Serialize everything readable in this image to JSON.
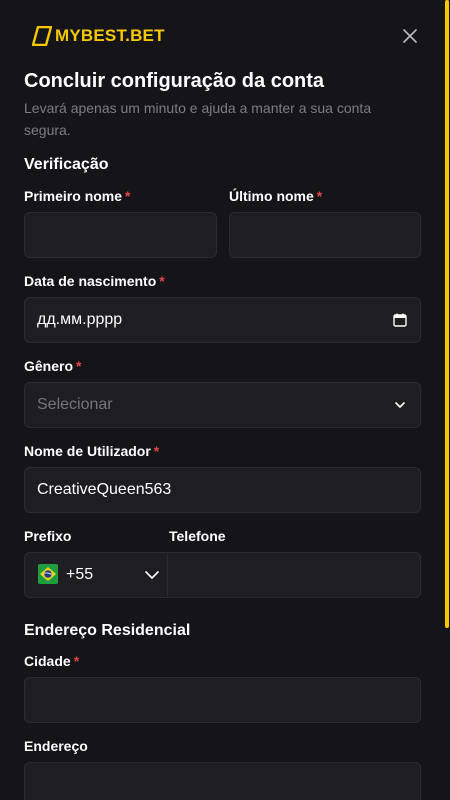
{
  "brand": {
    "logo_text": "MYBEST.BET",
    "accent": "#f6c800"
  },
  "dialog": {
    "title": "Concluir configuração da conta",
    "subtitle": "Levará apenas um minuto e ajuda a manter a sua conta segura."
  },
  "sections": {
    "verification": "Verificação",
    "address": "Endereço Residencial"
  },
  "required_mark": "*",
  "fields": {
    "first_name": {
      "label": "Primeiro nome",
      "value": ""
    },
    "last_name": {
      "label": "Último nome",
      "value": ""
    },
    "birth_date": {
      "label": "Data de nascimento",
      "placeholder": "дд.мм.рррр"
    },
    "gender": {
      "label": "Gênero",
      "placeholder": "Selecionar"
    },
    "username": {
      "label": "Nome de Utilizador",
      "value": "CreativeQueen563"
    },
    "prefix": {
      "label": "Prefixo",
      "value": "+55",
      "flag": "brazil-flag"
    },
    "phone": {
      "label": "Telefone",
      "value": ""
    },
    "city": {
      "label": "Cidade",
      "value": ""
    },
    "address": {
      "label": "Endereço",
      "value": ""
    }
  },
  "icons": {
    "close": "close-icon",
    "calendar": "calendar-icon",
    "chevron": "chevron-down-icon"
  }
}
